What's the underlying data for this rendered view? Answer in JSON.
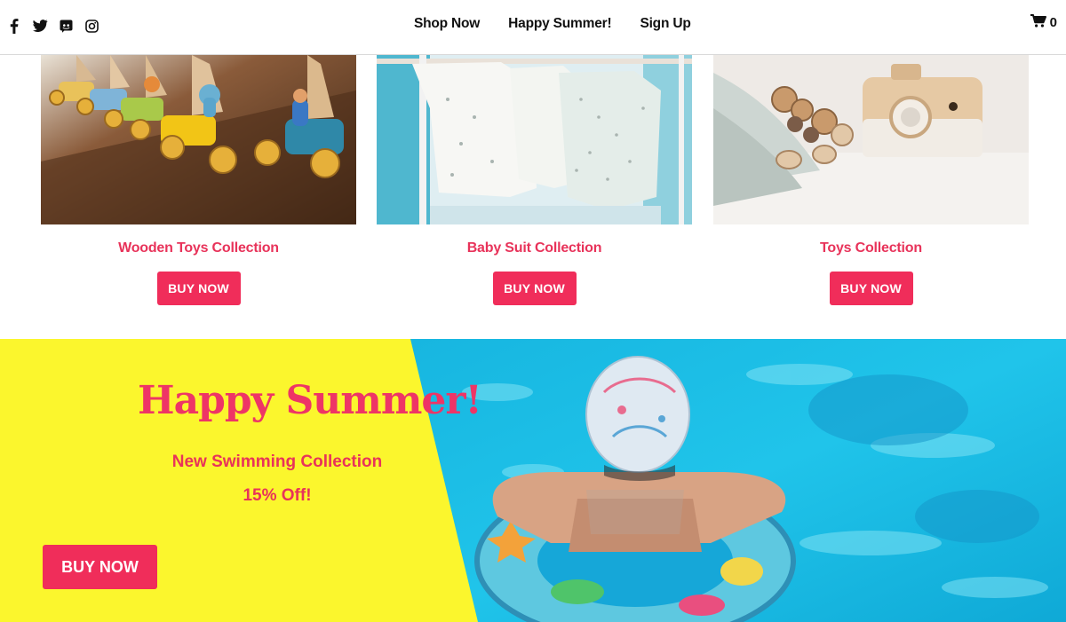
{
  "header": {
    "social_icons": [
      "facebook-icon",
      "twitter-icon",
      "discord-icon",
      "instagram-icon"
    ],
    "nav": [
      "Shop Now",
      "Happy Summer!",
      "Sign Up"
    ],
    "cart_count": "0"
  },
  "products": [
    {
      "title": "Wooden Toys Collection",
      "button": "BUY NOW"
    },
    {
      "title": "Baby Suit Collection",
      "button": "BUY NOW"
    },
    {
      "title": "Toys Collection",
      "button": "BUY NOW"
    }
  ],
  "banner": {
    "headline": "Happy Summer!",
    "subline": "New Swimming Collection",
    "offer": "15% Off!",
    "button": "BUY NOW"
  },
  "colors": {
    "accent": "#f02d5a",
    "accent_text": "#e8335a",
    "banner_yellow": "#fbf62d",
    "pool_blue": "#1ec3e8"
  }
}
